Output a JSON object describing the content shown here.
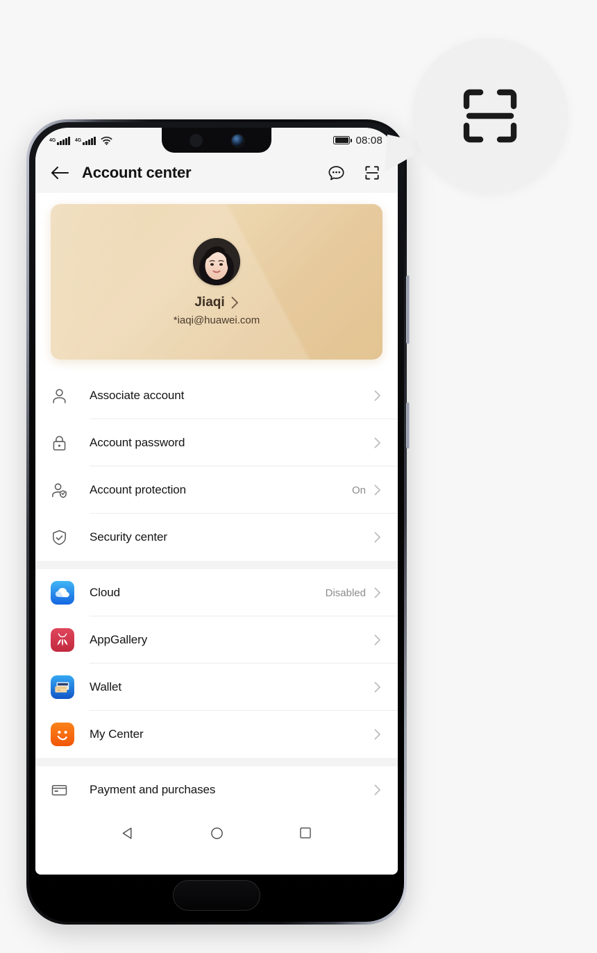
{
  "callout": {
    "icon": "scan-code-icon",
    "description": "magnified scan code icon"
  },
  "phone": {
    "status_bar": {
      "network_1": "4G",
      "network_2": "4G",
      "wifi_icon": "wifi-icon",
      "battery_icon": "battery-full-icon",
      "time": "08:08"
    },
    "header": {
      "back_icon": "back-arrow-icon",
      "title": "Account center",
      "chat_icon": "chat-bubble-icon",
      "scan_icon": "scan-code-icon"
    },
    "profile": {
      "avatar": "user-avatar",
      "name": "Jiaqi",
      "chevron": "chevron-right-icon",
      "email": "*iaqi@huawei.com"
    },
    "sections": [
      {
        "name": "account-settings",
        "rows": [
          {
            "icon": "person-icon",
            "label": "Associate account",
            "value": "",
            "chevron": "chevron-right-icon"
          },
          {
            "icon": "lock-icon",
            "label": "Account password",
            "value": "",
            "chevron": "chevron-right-icon"
          },
          {
            "icon": "person-shield-icon",
            "label": "Account protection",
            "value": "On",
            "chevron": "chevron-right-icon"
          },
          {
            "icon": "shield-check-icon",
            "label": "Security center",
            "value": "",
            "chevron": "chevron-right-icon"
          }
        ]
      },
      {
        "name": "huawei-services",
        "rows": [
          {
            "icon": "cloud-app-icon",
            "label": "Cloud",
            "value": "Disabled",
            "chevron": "chevron-right-icon"
          },
          {
            "icon": "appgallery-app-icon",
            "label": "AppGallery",
            "value": "",
            "chevron": "chevron-right-icon"
          },
          {
            "icon": "wallet-app-icon",
            "label": "Wallet",
            "value": "",
            "chevron": "chevron-right-icon"
          },
          {
            "icon": "my-center-app-icon",
            "label": "My Center",
            "value": "",
            "chevron": "chevron-right-icon"
          }
        ]
      },
      {
        "name": "payment",
        "rows": [
          {
            "icon": "credit-card-icon",
            "label": "Payment and purchases",
            "value": "",
            "chevron": "chevron-right-icon"
          }
        ]
      }
    ],
    "nav_bar": {
      "back_icon": "nav-back-triangle-icon",
      "home_icon": "nav-home-circle-icon",
      "recents_icon": "nav-recents-square-icon"
    },
    "fingerprint_sensor": "fingerprint-sensor"
  },
  "colors": {
    "page_background": "#f7f7f7",
    "card_gold": "#e9cfa3",
    "accent_blue": "#2196f3",
    "appgallery_red": "#d2334a",
    "my_center_orange": "#f96a16",
    "text_primary": "#141414",
    "text_secondary": "#8c8c8c"
  }
}
